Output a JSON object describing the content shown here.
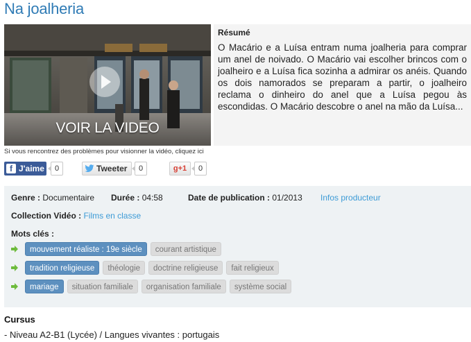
{
  "page": {
    "title": "Na joalheria"
  },
  "video": {
    "cta_label": "VOIR LA VIDEO",
    "help_text": "Si vous rencontrez des problèmes pour visionner la vidéo, cliquez ici"
  },
  "resume": {
    "heading": "Résumé",
    "text": "O Macário e a Luísa entram numa joalheria para comprar um anel de noivado. O Macário vai escolher brincos com o joalheiro e a Luísa fica sozinha a admirar os anéis. Quando os dois namorados se preparam a partir, o joalheiro reclama o dinheiro do anel que a Luísa pegou às escondidas. O Macário descobre o anel na mão da Luísa..."
  },
  "share": {
    "facebook_label": "J'aime",
    "facebook_count": "0",
    "twitter_label": "Tweeter",
    "twitter_count": "0",
    "gplus_label": "+1",
    "gplus_count": "0"
  },
  "meta": {
    "genre_key": "Genre :",
    "genre_value": "Documentaire",
    "duree_key": "Durée :",
    "duree_value": "04:58",
    "date_key": "Date de publication :",
    "date_value": "01/2013",
    "producer_link": "Infos producteur",
    "collection_key": "Collection Vidéo :",
    "collection_value": "Films en classe",
    "keywords_heading": "Mots clés :"
  },
  "keywords": [
    {
      "tags": [
        {
          "label": "mouvement réaliste : 19e siècle",
          "active": true
        },
        {
          "label": "courant artistique",
          "active": false
        }
      ]
    },
    {
      "tags": [
        {
          "label": "tradition religieuse",
          "active": true
        },
        {
          "label": "théologie",
          "active": false
        },
        {
          "label": "doctrine religieuse",
          "active": false
        },
        {
          "label": "fait religieux",
          "active": false
        }
      ]
    },
    {
      "tags": [
        {
          "label": "mariage",
          "active": true
        },
        {
          "label": "situation familiale",
          "active": false
        },
        {
          "label": "organisation familiale",
          "active": false
        },
        {
          "label": "système social",
          "active": false
        }
      ]
    }
  ],
  "cursus": {
    "heading": "Cursus",
    "item": "- Niveau A2-B1 (Lycée) / Langues vivantes : portugais"
  },
  "colors": {
    "title_blue": "#2f7bb5",
    "link_blue": "#3d9bd6",
    "tag_active": "#5d90bf",
    "tag_inactive": "#dcdcdc",
    "arrow_green": "#6dbb3c",
    "facebook": "#3b5b98"
  },
  "icons": {
    "play": "play-icon",
    "facebook": "facebook-icon",
    "twitter": "twitter-bird-icon",
    "gplus": "google-plus-icon",
    "arrow": "green-arrow-right-icon"
  }
}
